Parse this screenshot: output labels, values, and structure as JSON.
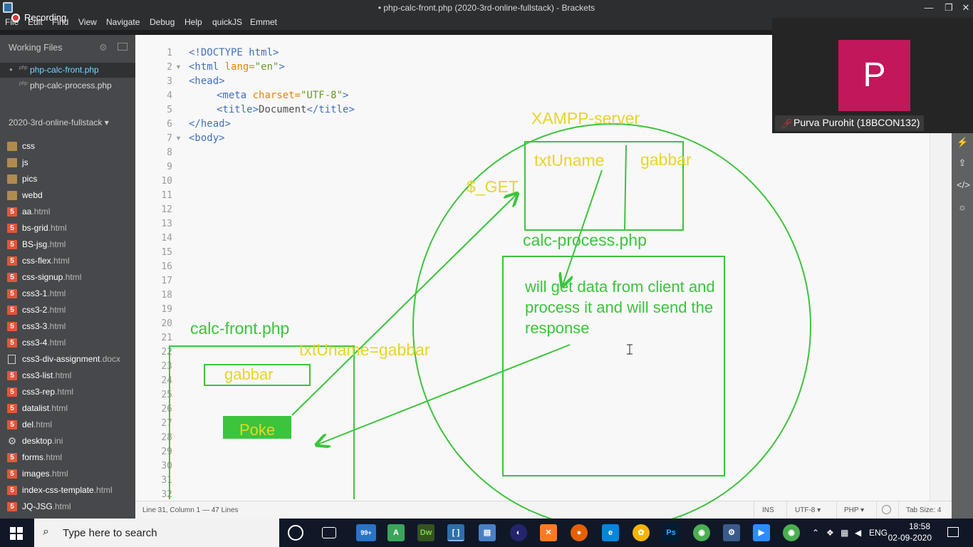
{
  "window": {
    "title": "• php-calc-front.php (2020-3rd-online-fullstack) - Brackets",
    "controls": [
      "—",
      "❐",
      "✕"
    ]
  },
  "menu": [
    "File",
    "Edit",
    "Find",
    "View",
    "Navigate",
    "Debug",
    "Help",
    "quickJS",
    "Emmet"
  ],
  "recording_label": "Recording",
  "sidebar": {
    "working_files_title": "Working Files",
    "working_files": [
      {
        "ext": "php",
        "name": "php-calc-front.php",
        "active": true
      },
      {
        "ext": "php",
        "name": "php-calc-process.php",
        "active": false
      }
    ],
    "project_title": "2020-3rd-online-fullstack ▾",
    "tree": [
      {
        "type": "folder",
        "base": "css",
        "ext": ""
      },
      {
        "type": "folder",
        "base": "js",
        "ext": ""
      },
      {
        "type": "folder",
        "base": "pics",
        "ext": ""
      },
      {
        "type": "folder",
        "base": "webd",
        "ext": ""
      },
      {
        "type": "html5",
        "base": "aa",
        "ext": ".html"
      },
      {
        "type": "html5",
        "base": "bs-grid",
        "ext": ".html"
      },
      {
        "type": "html5",
        "base": "BS-jsg",
        "ext": ".html"
      },
      {
        "type": "html5",
        "base": "css-flex",
        "ext": ".html"
      },
      {
        "type": "html5",
        "base": "css-signup",
        "ext": ".html"
      },
      {
        "type": "html5",
        "base": "css3-1",
        "ext": ".html"
      },
      {
        "type": "html5",
        "base": "css3-2",
        "ext": ".html"
      },
      {
        "type": "html5",
        "base": "css3-3",
        "ext": ".html"
      },
      {
        "type": "html5",
        "base": "css3-4",
        "ext": ".html"
      },
      {
        "type": "doc",
        "base": "css3-div-assignment",
        "ext": ".docx"
      },
      {
        "type": "html5",
        "base": "css3-list",
        "ext": ".html"
      },
      {
        "type": "html5",
        "base": "css3-rep",
        "ext": ".html"
      },
      {
        "type": "html5",
        "base": "datalist",
        "ext": ".html"
      },
      {
        "type": "html5",
        "base": "del",
        "ext": ".html"
      },
      {
        "type": "gear",
        "base": "desktop",
        "ext": ".ini"
      },
      {
        "type": "html5",
        "base": "forms",
        "ext": ".html"
      },
      {
        "type": "html5",
        "base": "images",
        "ext": ".html"
      },
      {
        "type": "html5",
        "base": "index-css-template",
        "ext": ".html"
      },
      {
        "type": "html5",
        "base": "JQ-JSG",
        "ext": ".html"
      }
    ]
  },
  "editor": {
    "line_numbers": [
      "1",
      "2",
      "3",
      "4",
      "5",
      "6",
      "7",
      "8",
      "9",
      "10",
      "11",
      "12",
      "13",
      "14",
      "15",
      "16",
      "17",
      "18",
      "19",
      "20",
      "21",
      "22",
      "23",
      "24",
      "25",
      "26",
      "27",
      "28",
      "29",
      "30",
      "31",
      "32"
    ],
    "code": {
      "l1": "<!DOCTYPE html>",
      "l2_open": "<html",
      "l2_attr": " lang=",
      "l2_val": "\"en\"",
      "l2_close": ">",
      "l3": "<head>",
      "l4_open": "<meta",
      "l4_attr": " charset=",
      "l4_val": "\"UTF-8\"",
      "l4_close": ">",
      "l5_open": "<title>",
      "l5_text": "Document",
      "l5_close": "</title>",
      "l6": "</head>",
      "l7": "<body>"
    }
  },
  "annotations": {
    "xampp": "XAMPP-server",
    "get": "$_GET",
    "txt_uname": "txtUname",
    "gabbar_right": "gabbar",
    "calc_process": "calc-process.php",
    "process_note": [
      "will get data from client and",
      "process it and will send the",
      "response"
    ],
    "calc_front": "calc-front.php",
    "query": "txtUname=gabbar",
    "gabbar_input": "gabbar",
    "poke": "Poke",
    "colors": {
      "green": "#3cc43c",
      "yellow": "#e8d52a"
    }
  },
  "statusbar": {
    "position": "Line 31, Column 1 — 47 Lines",
    "ins": "INS",
    "encoding": "UTF-8 ▾",
    "language": "PHP ▾",
    "tab_size": "Tab Size:  4"
  },
  "video": {
    "avatar_letter": "P",
    "participant": "Purva Purohit (18BCON132)"
  },
  "taskbar": {
    "search_placeholder": "Type here to search",
    "badge": "99+",
    "language": "ENG",
    "time": "18:58",
    "date": "02-09-2020"
  }
}
